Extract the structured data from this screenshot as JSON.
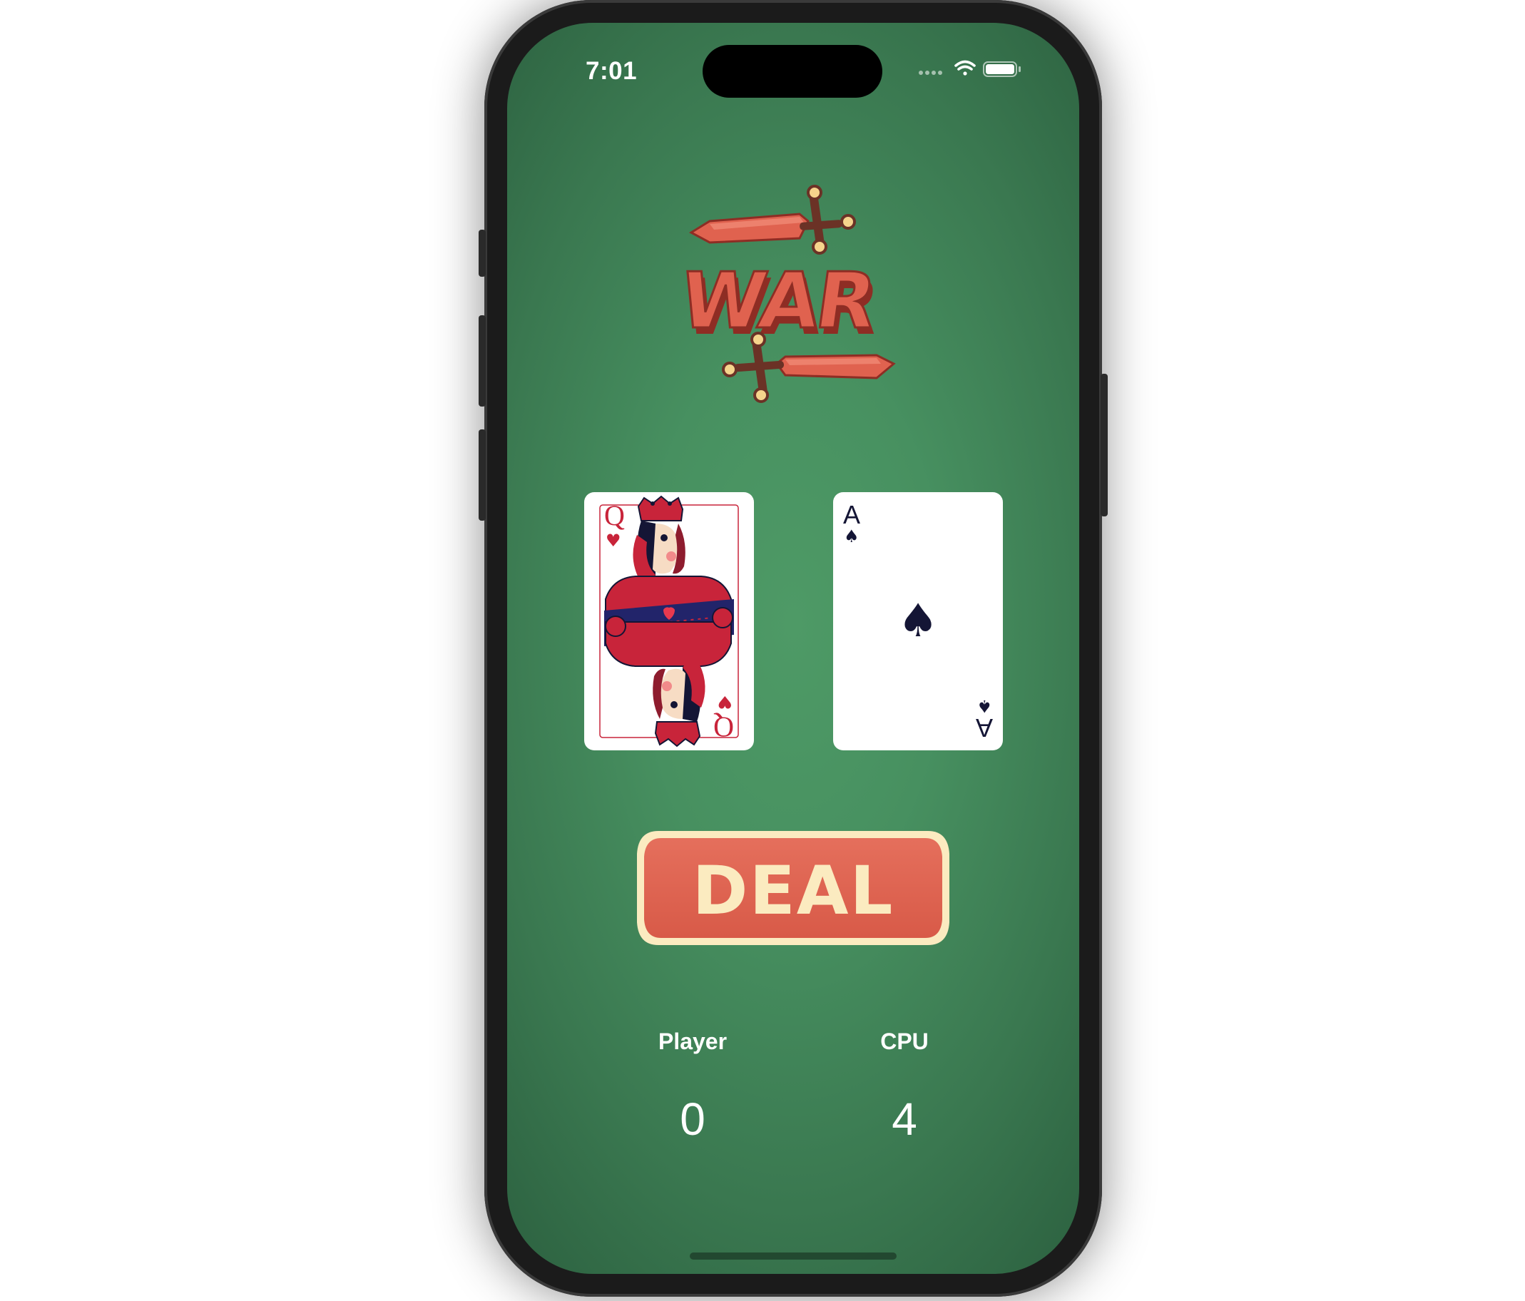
{
  "status_bar": {
    "time": "7:01",
    "icons": [
      "cellular-dots-icon",
      "wifi-icon",
      "battery-icon"
    ]
  },
  "logo": {
    "text": "WAR",
    "colors": {
      "primary": "#E0624F",
      "shadow": "#8E2D24",
      "hilt": "#6B3226",
      "pommel": "#F6D48C"
    }
  },
  "cards": {
    "player": {
      "rank": "Q",
      "suit": "hearts",
      "suit_symbol": "♥",
      "color": "#C8243A"
    },
    "cpu": {
      "rank": "A",
      "suit": "spades",
      "suit_symbol": "♠",
      "color": "#141535"
    }
  },
  "deal_button": {
    "label": "DEAL",
    "colors": {
      "fill": "#E0624F",
      "border": "#FBEBC0",
      "text": "#FBEBC0"
    }
  },
  "scores": {
    "player_label": "Player",
    "player_value": "0",
    "cpu_label": "CPU",
    "cpu_value": "4"
  },
  "theme": {
    "felt_green": "#479060",
    "felt_dark": "#2E6442"
  }
}
